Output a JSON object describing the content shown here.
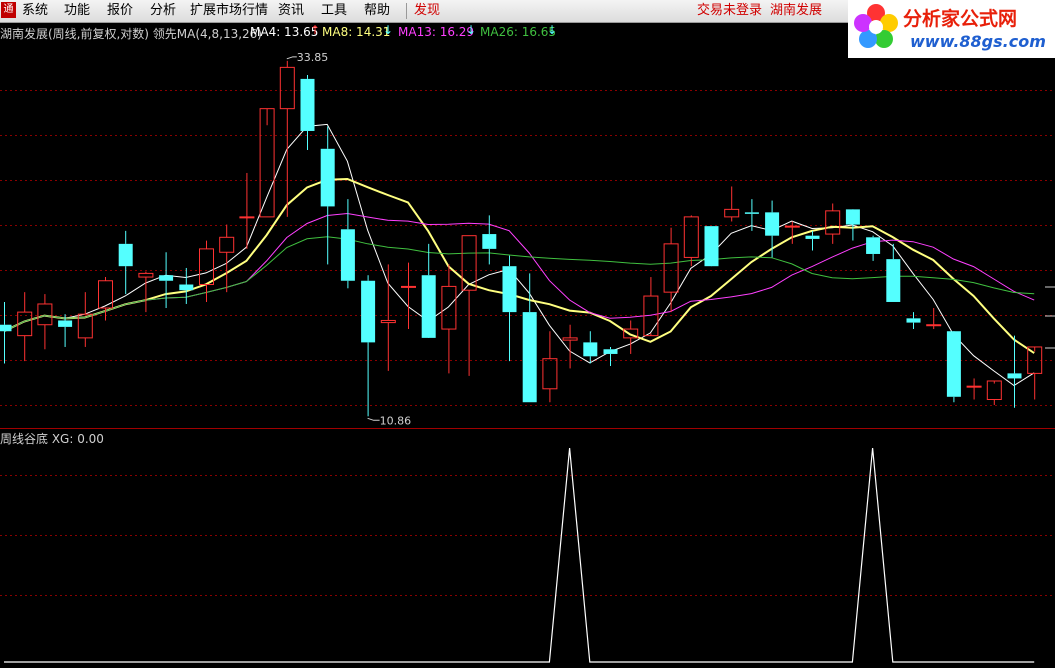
{
  "menu": {
    "app_icon": "通",
    "items": [
      "系统",
      "功能",
      "报价",
      "分析",
      "扩展市场行情",
      "资讯",
      "工具",
      "帮助"
    ],
    "discover": "发现",
    "login": "交易未登录",
    "stock": "湖南发展"
  },
  "logo": {
    "text": "分析家公式网",
    "url": "www.88gs.com"
  },
  "indicators": {
    "main_title": "湖南发展(周线,前复权,对数) 领先MA(4,8,13,26)",
    "ma4": "MA4: 13.65",
    "ma8": "MA8: 14.31",
    "ma13": "MA13: 16.29",
    "ma26": "MA26: 16.65",
    "sub_title": "周线谷底 XG: 0.00",
    "high_label": "33.85",
    "low_label": "10.86"
  },
  "colors": {
    "up": "#ff3232",
    "down": "#54ffff",
    "ma4": "#ffffff",
    "ma8": "#ffff80",
    "ma13": "#ff40ff",
    "ma26": "#40c040",
    "signal": "#ffffff"
  },
  "chart_data": [
    {
      "type": "candlestick",
      "title": "湖南发展(周线,前复权,对数)",
      "scale": "log",
      "ohlc": [
        [
          14.6,
          15.7,
          12.9,
          14.3
        ],
        [
          14.1,
          16.2,
          13.0,
          15.2
        ],
        [
          14.6,
          16.1,
          13.5,
          15.6
        ],
        [
          14.8,
          15.1,
          13.6,
          14.5
        ],
        [
          14.0,
          16.2,
          13.6,
          15.1
        ],
        [
          15.4,
          17.0,
          14.8,
          16.8
        ],
        [
          18.9,
          19.7,
          16.1,
          17.6
        ],
        [
          17.0,
          17.3,
          15.2,
          17.2
        ],
        [
          17.1,
          18.4,
          15.4,
          16.8
        ],
        [
          16.6,
          17.5,
          15.6,
          16.3
        ],
        [
          16.6,
          19.1,
          15.7,
          18.6
        ],
        [
          18.4,
          20.1,
          16.2,
          19.3
        ],
        [
          20.6,
          23.7,
          18.6,
          20.6
        ],
        [
          20.6,
          27.6,
          20.6,
          29.1
        ],
        [
          29.1,
          33.9,
          20.6,
          33.2
        ],
        [
          32.0,
          32.4,
          25.5,
          27.1
        ],
        [
          25.6,
          27.5,
          17.7,
          21.3
        ],
        [
          19.8,
          21.8,
          16.4,
          16.8
        ],
        [
          16.8,
          17.1,
          10.9,
          13.8
        ],
        [
          14.7,
          17.7,
          12.6,
          14.8
        ],
        [
          16.5,
          17.8,
          14.4,
          16.5
        ],
        [
          17.1,
          18.9,
          14.8,
          14.0
        ],
        [
          14.4,
          17.7,
          12.5,
          16.5
        ],
        [
          16.3,
          19.4,
          12.4,
          19.4
        ],
        [
          19.5,
          20.7,
          17.7,
          18.6
        ],
        [
          17.6,
          18.2,
          13.0,
          15.2
        ],
        [
          15.2,
          17.2,
          11.4,
          11.4
        ],
        [
          11.9,
          14.3,
          11.4,
          13.1
        ],
        [
          13.9,
          14.6,
          12.7,
          14.0
        ],
        [
          13.8,
          14.3,
          12.9,
          13.2
        ],
        [
          13.5,
          13.6,
          12.8,
          13.3
        ],
        [
          14.0,
          14.8,
          13.3,
          14.4
        ],
        [
          14.1,
          17.0,
          14.2,
          16.0
        ],
        [
          16.2,
          19.9,
          15.2,
          18.9
        ],
        [
          18.1,
          20.7,
          17.6,
          20.6
        ],
        [
          20.0,
          20.0,
          17.9,
          17.6
        ],
        [
          20.6,
          22.7,
          20.3,
          21.1
        ],
        [
          20.9,
          21.8,
          19.7,
          20.8
        ],
        [
          20.9,
          21.7,
          18.1,
          19.4
        ],
        [
          20.0,
          20.3,
          18.9,
          20.0
        ],
        [
          19.4,
          19.7,
          18.5,
          19.2
        ],
        [
          19.5,
          21.5,
          18.9,
          21.0
        ],
        [
          21.1,
          21.0,
          19.1,
          20.1
        ],
        [
          19.3,
          19.4,
          17.9,
          18.3
        ],
        [
          18.0,
          18.9,
          15.7,
          15.7
        ],
        [
          14.9,
          15.2,
          14.4,
          14.7
        ],
        [
          14.6,
          15.4,
          14.4,
          14.6
        ],
        [
          14.3,
          13.5,
          11.4,
          11.6
        ],
        [
          12.0,
          12.3,
          11.5,
          12.0
        ],
        [
          11.5,
          12.1,
          11.3,
          12.2
        ],
        [
          12.5,
          14.1,
          11.2,
          12.3
        ],
        [
          12.5,
          13.4,
          11.5,
          13.6
        ]
      ],
      "ylim": [
        10.5,
        36
      ],
      "annotations": [
        "33.85",
        "10.86"
      ]
    },
    {
      "type": "line",
      "title": "周线谷底",
      "series": [
        {
          "name": "XG",
          "values": [
            0,
            0,
            0,
            0,
            0,
            0,
            0,
            0,
            0,
            0,
            0,
            0,
            0,
            0,
            0,
            0,
            0,
            0,
            0,
            0,
            0,
            0,
            0,
            0,
            0,
            0,
            0,
            0,
            1,
            0,
            0,
            0,
            0,
            0,
            0,
            0,
            0,
            0,
            0,
            0,
            0,
            0,
            0,
            1,
            0,
            0,
            0,
            0,
            0,
            0,
            0,
            0
          ]
        }
      ]
    }
  ]
}
